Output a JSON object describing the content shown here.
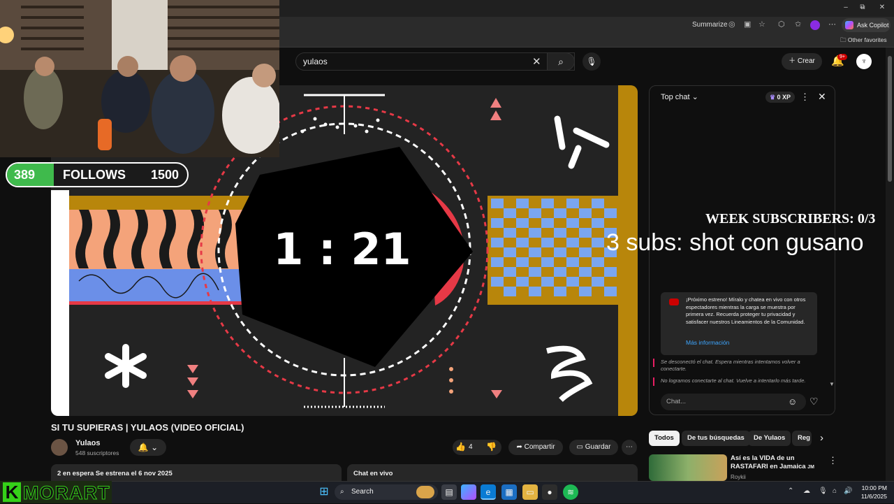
{
  "browser": {
    "summarize_label": "Summarize",
    "copilot_label": "Ask Copilot",
    "other_favorites_label": "Other favorites",
    "window_controls": [
      "–",
      "⧉",
      "✕"
    ]
  },
  "youtube": {
    "search_value": "yulaos",
    "create_label": "Crear",
    "notification_badge": "9+",
    "player": {
      "countdown": "1 : 21"
    },
    "video": {
      "title": "SI TU SUPIERAS | YULAOS (VIDEO OFICIAL)",
      "channel_name": "Yulaos",
      "channel_subs": "548 suscriptores",
      "like_count": "4",
      "share_label": "Compartir",
      "save_label": "Guardar",
      "description_header": "2 en espera  Se estrena el 6 nov 2025",
      "live_chat_header": "Chat en vivo"
    },
    "chat": {
      "title": "Top chat",
      "xp_label": "0 XP",
      "notice_text": "¡Próximo estreno! Míralo y chatea en vivo con otros espectadores mientras la carga se muestra por primera vez. Recuerda proteger tu privacidad y satisfacer nuestros Lineamientos de la Comunidad.",
      "notice_link": "Más información",
      "system_messages": [
        "Se desconectó el chat. Espera mientras intentamos volver a conectarte.",
        "No logramos conectarte al chat. Vuelve a intentarlo más tarde."
      ],
      "input_placeholder": "Chat..."
    },
    "chips": [
      "Todos",
      "De tus búsquedas",
      "De Yulaos",
      "Reg"
    ],
    "recommendation": {
      "title": "Así es la VIDA de un RASTAFARI en Jamaica",
      "title_suffix": "JM",
      "channel": "Roykii"
    }
  },
  "overlays": {
    "follows_current": "389",
    "follows_label": "FOLLOWS",
    "follows_goal": "1500",
    "follows_progress": 0.26,
    "week_subscribers": "WEEK SUBSCRIBERS: 0/3",
    "subs_goal": "3 subs: shot con gusano",
    "morart_letter": "K",
    "morart_text": "MORART"
  },
  "taskbar": {
    "search_placeholder": "Search",
    "time": "10:00 PM",
    "date": "11/6/2025"
  },
  "colors": {
    "accent_green": "#35d119",
    "link_blue": "#3ea6ff",
    "badge_red": "#cc0000"
  }
}
